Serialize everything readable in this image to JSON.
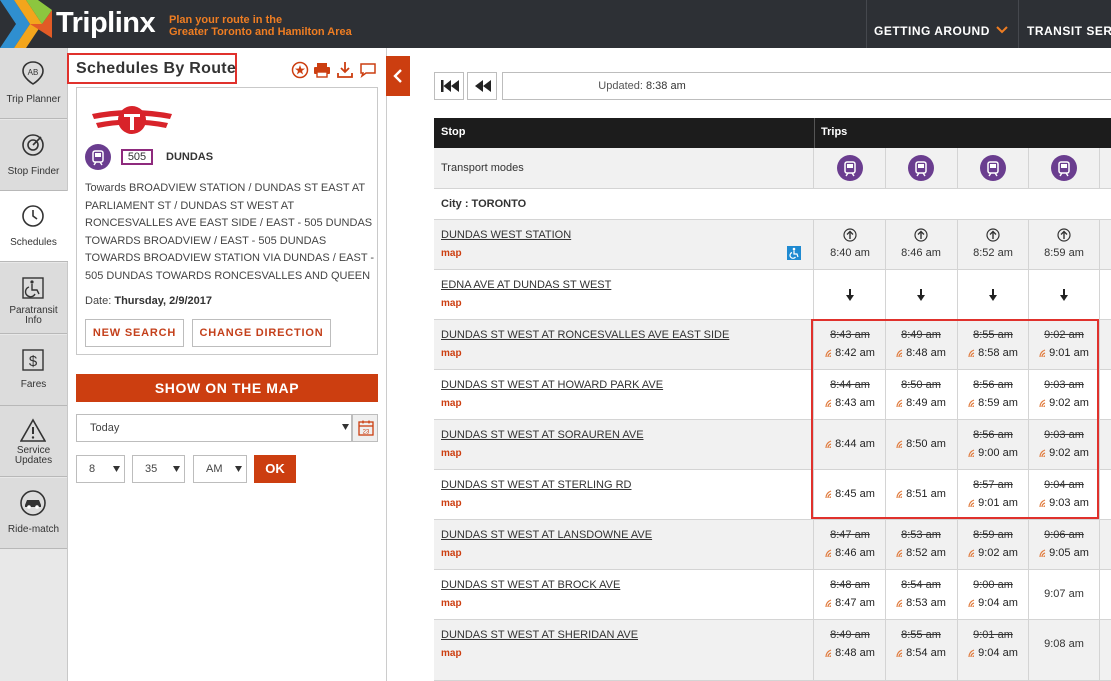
{
  "header": {
    "brand": "Triplinx",
    "tagline_line1": "Plan your route in the",
    "tagline_line2": "Greater Toronto and Hamilton Area",
    "nav": [
      {
        "label": "GETTING AROUND"
      },
      {
        "label": "TRANSIT SERV"
      }
    ],
    "colors": {
      "bar": "#2d3035",
      "accent": "#ef7d22"
    }
  },
  "sidenav": {
    "items": [
      {
        "label": "Trip Planner",
        "icon": "trip-planner-icon"
      },
      {
        "label": "Stop Finder",
        "icon": "stop-finder-icon"
      },
      {
        "label": "Schedules",
        "icon": "clock-icon",
        "active": true
      },
      {
        "label_line1": "Paratransit",
        "label_line2": "Info",
        "icon": "wheelchair-icon"
      },
      {
        "label": "Fares",
        "icon": "dollar-icon"
      },
      {
        "label_line1": "Service",
        "label_line2": "Updates",
        "icon": "warning-icon"
      },
      {
        "label": "Ride-match",
        "icon": "car-icon"
      }
    ]
  },
  "panel": {
    "title": "Schedules By Route",
    "route": {
      "number": "505",
      "name": "DUNDAS",
      "description": "Towards BROADVIEW STATION / DUNDAS ST EAST AT PARLIAMENT ST / DUNDAS ST WEST AT RONCESVALLES AVE EAST SIDE / EAST - 505 DUNDAS TOWARDS BROADVIEW / EAST - 505 DUNDAS TOWARDS BROADVIEW STATION VIA DUNDAS / EAST - 505 DUNDAS TOWARDS RONCESVALLES AND QUEEN",
      "date_label": "Date:",
      "date_value": "Thursday, 2/9/2017"
    },
    "new_search_label": "NEW SEARCH",
    "change_direction_label": "CHANGE DIRECTION",
    "show_map_label": "SHOW ON THE MAP",
    "day_select": "Today",
    "hour": "8",
    "minute": "35",
    "ampm": "AM",
    "ok_label": "OK",
    "colors": {
      "primary": "#cc3e10",
      "route_badge": "#8e2a7d",
      "mode": "#6a3d8f"
    }
  },
  "schedule": {
    "updated_label": "Updated:",
    "updated_time": "8:38 am",
    "col_stop": "Stop",
    "col_trips": "Trips",
    "transport_modes_label": "Transport modes",
    "city_label": "City : TORONTO",
    "map_link": "map",
    "stops": [
      {
        "name": "DUNDAS WEST STATION",
        "times": [
          {
            "real": "8:40 am"
          },
          {
            "real": "8:46 am"
          },
          {
            "real": "8:52 am"
          },
          {
            "real": "8:59 am"
          }
        ]
      },
      {
        "name": "EDNA AVE AT DUNDAS ST WEST",
        "times": []
      },
      {
        "name": "DUNDAS ST WEST AT RONCESVALLES AVE EAST SIDE",
        "times": [
          {
            "sched": "8:43 am",
            "real": "8:42 am"
          },
          {
            "sched": "8:49 am",
            "real": "8:48 am"
          },
          {
            "sched": "8:55 am",
            "real": "8:58 am"
          },
          {
            "sched": "9:02 am",
            "real": "9:01 am"
          }
        ]
      },
      {
        "name": "DUNDAS ST WEST AT HOWARD PARK AVE",
        "times": [
          {
            "sched": "8:44 am",
            "real": "8:43 am"
          },
          {
            "sched": "8:50 am",
            "real": "8:49 am"
          },
          {
            "sched": "8:56 am",
            "real": "8:59 am"
          },
          {
            "sched": "9:03 am",
            "real": "9:02 am"
          }
        ]
      },
      {
        "name": "DUNDAS ST WEST AT SORAUREN AVE",
        "times": [
          {
            "real": "8:44 am"
          },
          {
            "real": "8:50 am"
          },
          {
            "sched": "8:56 am",
            "real": "9:00 am"
          },
          {
            "sched": "9:03 am",
            "real": "9:02 am"
          }
        ]
      },
      {
        "name": "DUNDAS ST WEST AT STERLING RD",
        "times": [
          {
            "real": "8:45 am"
          },
          {
            "real": "8:51 am"
          },
          {
            "sched": "8:57 am",
            "real": "9:01 am"
          },
          {
            "sched": "9:04 am",
            "real": "9:03 am"
          }
        ]
      },
      {
        "name": "DUNDAS ST WEST AT LANSDOWNE AVE",
        "times": [
          {
            "sched": "8:47 am",
            "real": "8:46 am"
          },
          {
            "sched": "8:53 am",
            "real": "8:52 am"
          },
          {
            "sched": "8:59 am",
            "real": "9:02 am"
          },
          {
            "sched": "9:06 am",
            "real": "9:05 am"
          }
        ]
      },
      {
        "name": "DUNDAS ST WEST AT BROCK AVE",
        "times": [
          {
            "sched": "8:48 am",
            "real": "8:47 am"
          },
          {
            "sched": "8:54 am",
            "real": "8:53 am"
          },
          {
            "sched": "9:00 am",
            "real": "9:04 am"
          },
          {
            "plain": "9:07 am"
          }
        ]
      },
      {
        "name": "DUNDAS ST WEST AT SHERIDAN AVE",
        "times": [
          {
            "sched": "8:49 am",
            "real": "8:48 am"
          },
          {
            "sched": "8:55 am",
            "real": "8:54 am"
          },
          {
            "sched": "9:01 am",
            "real": "9:04 am"
          },
          {
            "plain": "9:08 am"
          }
        ]
      }
    ]
  }
}
